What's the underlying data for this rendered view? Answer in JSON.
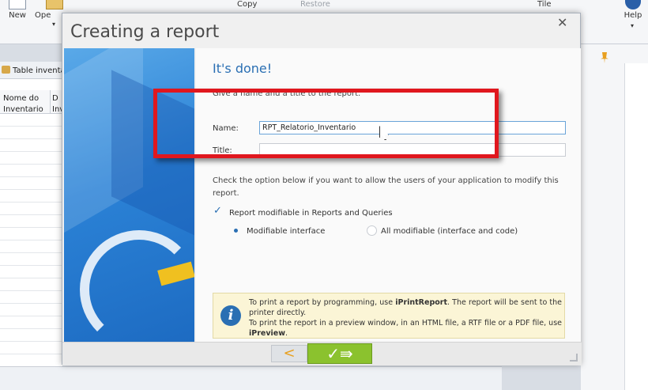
{
  "ribbon": {
    "new_label": "New",
    "open_label": "Ope",
    "copy_label": "Copy",
    "restore_label": "Restore",
    "tile_label": "Tile",
    "help_label": "Help"
  },
  "left_pane": {
    "title": "Table inventa",
    "col1": "Nome do Inventario",
    "col2": "D Inv"
  },
  "dialog": {
    "title": "Creating a report",
    "heading": "It's done!",
    "subtext": "Give a name and a title to the report.",
    "name_label": "Name:",
    "name_value": "RPT_Relatorio_Inventario",
    "title_label": "Title:",
    "title_value": "",
    "description": "Check the option below if you want to allow the users of your application to modify this report.",
    "checkbox_label": "Report modifiable in Reports and Queries",
    "checkbox_checked": true,
    "radio_options": [
      {
        "label": "Modifiable interface",
        "selected": true
      },
      {
        "label": "All modifiable (interface and code)",
        "selected": false
      }
    ],
    "info": {
      "line1a": "To print a report by programming, use ",
      "line1b": "iPrintReport",
      "line1c": ". The report will be sent to the printer directly.",
      "line2a": "To print the report in a preview window, in an HTML file, a RTF file or a PDF file, use ",
      "line2b": "iPreview",
      "line2c": "."
    },
    "back_symbol": "<",
    "finish_symbol": "✓⇛"
  },
  "colors": {
    "accent_blue": "#2a6fb3",
    "highlight_red": "#e0171e",
    "finish_green": "#8bc22e",
    "info_bg": "#fbf5d6"
  }
}
